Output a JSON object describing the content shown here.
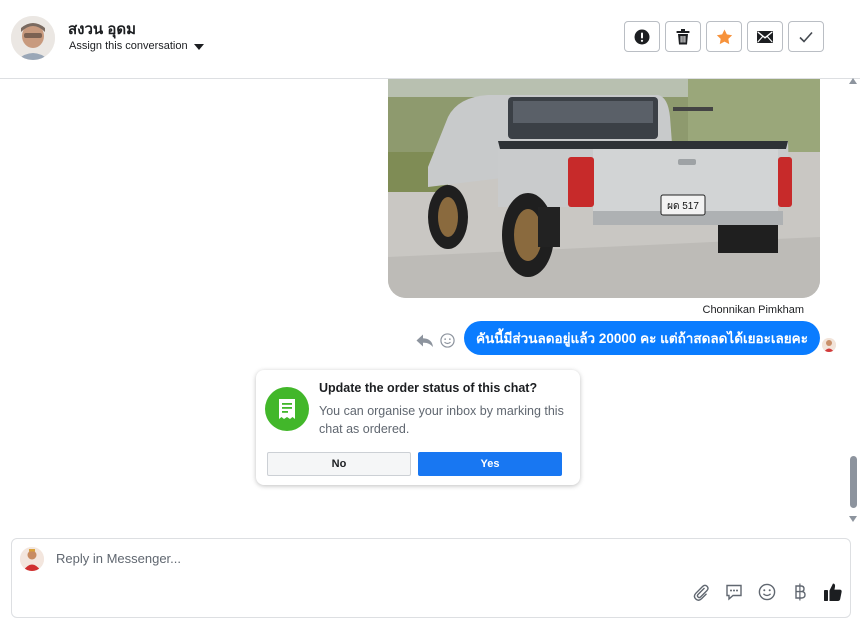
{
  "header": {
    "contact_name": "สงวน อุดม",
    "assign_label": "Assign this conversation",
    "actions": [
      {
        "name": "mark-spam",
        "icon": "exclamation-icon"
      },
      {
        "name": "delete",
        "icon": "trash-icon"
      },
      {
        "name": "star",
        "icon": "star-icon"
      },
      {
        "name": "mark-unread",
        "icon": "envelope-icon"
      },
      {
        "name": "mark-done",
        "icon": "checkmark-icon"
      }
    ]
  },
  "chat": {
    "sender_name": "Chonnikan Pimkham",
    "message_text": "คันนี้มีส่วนลดอยู่แล้ว 20000 คะ แต่ถ้าสดลดได้เยอะเลยคะ",
    "license_plate": "ผด 517"
  },
  "prompt": {
    "title": "Update the order status of this chat?",
    "body": "You can organise your inbox by marking this chat as ordered.",
    "no_label": "No",
    "yes_label": "Yes"
  },
  "composer": {
    "placeholder": "Reply in Messenger...",
    "tools": [
      "paperclip-icon",
      "comment-icon",
      "emoji-icon",
      "baht-icon",
      "thumbs-up-icon"
    ]
  },
  "colors": {
    "bubble": "#0a7cff",
    "yes_button": "#1877f2",
    "prompt_icon": "#42b72a",
    "star": "#f7923b"
  }
}
